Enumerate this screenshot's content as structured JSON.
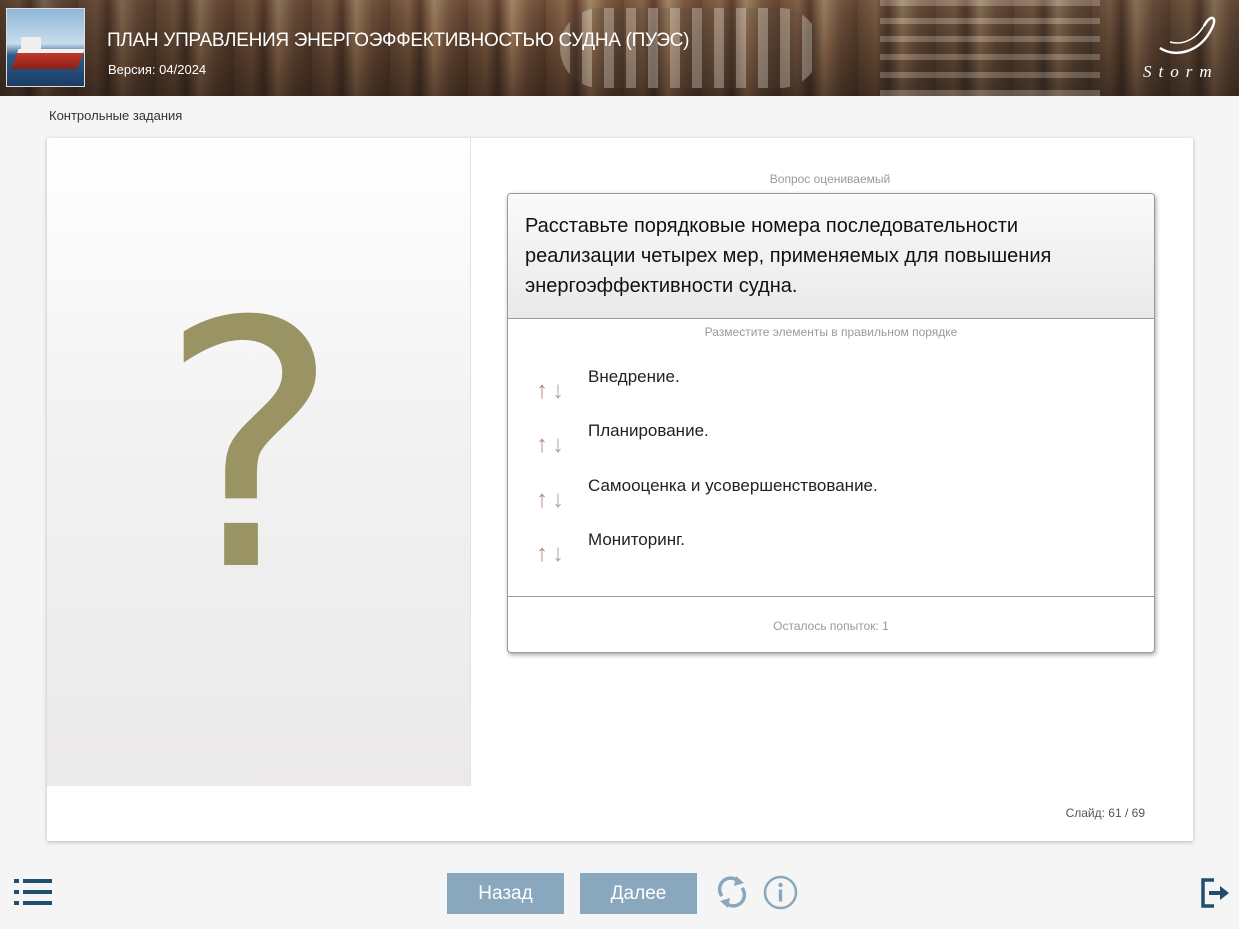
{
  "header": {
    "title": "ПЛАН УПРАВЛЕНИЯ ЭНЕРГОЭФФЕКТИВНОСТЬЮ СУДНА (ПУЭС)",
    "version": "Версия: 04/2024",
    "logo_text": "Storm"
  },
  "section_label": "Контрольные задания",
  "left_panel": {
    "symbol": "?"
  },
  "question": {
    "caption": "Вопрос оцениваемый",
    "text": "Расставьте  порядковые номера последовательности реализации четырех мер, применяемых для повышения энергоэффективности судна.",
    "instruction": "Разместите элементы в правильном порядке",
    "items": [
      {
        "label": "Внедрение."
      },
      {
        "label": "Планирование."
      },
      {
        "label": "Самооценка и усовершенствование."
      },
      {
        "label": "Мониторинг."
      }
    ],
    "attempts": "Осталось попыток: 1"
  },
  "slide_counter": "Слайд:  61 / 69",
  "nav": {
    "back_label": "Назад",
    "next_label": "Далее"
  },
  "colors": {
    "accent_button": "#8aa8bd",
    "question_mark": "#9a9465",
    "icon_blue": "#1f4e6e"
  }
}
